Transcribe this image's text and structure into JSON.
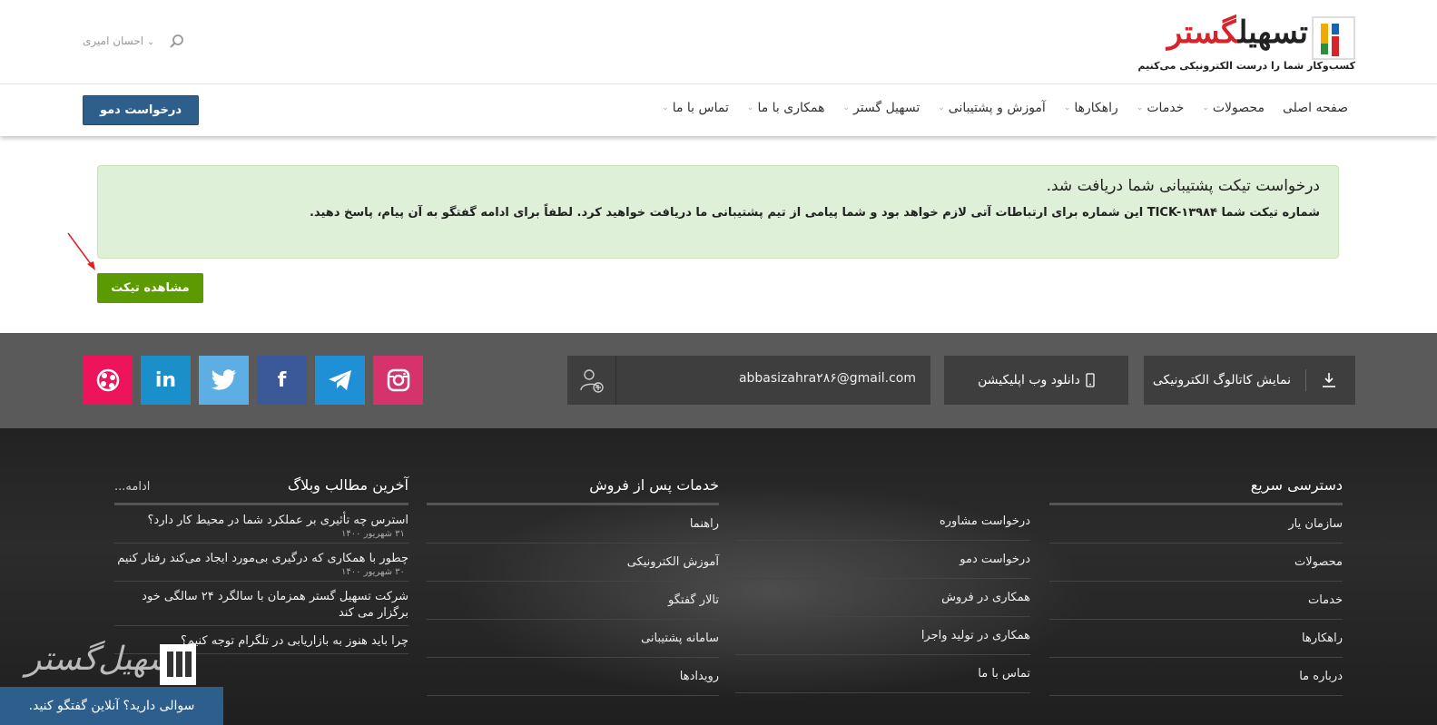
{
  "header": {
    "logo_text": "تسهیل‌گستر",
    "logo_tagline": "کسب‌وکار شما را درست الکترونیکی می‌کنیم",
    "user_name": "احسان امیری",
    "user_chevron": "⌄"
  },
  "nav": {
    "items": [
      {
        "label": "صفحه اصلی",
        "has_chevron": false
      },
      {
        "label": "محصولات",
        "has_chevron": true
      },
      {
        "label": "خدمات",
        "has_chevron": true
      },
      {
        "label": "راهکارها",
        "has_chevron": true
      },
      {
        "label": "آموزش و پشتیبانی",
        "has_chevron": true
      },
      {
        "label": "تسهیل گستر",
        "has_chevron": true
      },
      {
        "label": "همکاری با ما",
        "has_chevron": true
      },
      {
        "label": "تماس با ما",
        "has_chevron": true
      }
    ],
    "demo_button": "درخواست دمو"
  },
  "alert": {
    "title": "درخواست تیکت پشتیبانی شما دریافت شد.",
    "message": "شماره تیکت شما TICK-۱۳۹۸۴ این شماره برای ارتباطات آتی لازم خواهد بود و شما پیامی از تیم پشتیبانی ما دریافت خواهید کرد. لطفاً برای ادامه گفتگو به آن پیام، پاسخ دهید.",
    "color": "#dff0d8"
  },
  "ticket_button": "مشاهده تیکت",
  "footer_strip": {
    "catalog_button": "نمایش کاتالوگ الکترونیکی",
    "app_button": "دانلود وب اپلیکیشن",
    "email_value": "abbasizahra۲۸۶@gmail.com",
    "socials": [
      {
        "name": "aparat",
        "color": "#ed145b"
      },
      {
        "name": "linkedin",
        "color": "#1a8fc9"
      },
      {
        "name": "twitter",
        "color": "#5eaee6"
      },
      {
        "name": "facebook",
        "color": "#3b5998"
      },
      {
        "name": "telegram",
        "color": "#1f8fd6"
      },
      {
        "name": "instagram",
        "color": "#d6336c"
      }
    ]
  },
  "footer": {
    "quick_access": {
      "title": "دسترسی سریع",
      "items": [
        "سازمان یار",
        "محصولات",
        "خدمات",
        "راهکارها",
        "درباره ما"
      ]
    },
    "services_col2": {
      "items": [
        "درخواست مشاوره",
        "درخواست دمو",
        "همکاری در فروش",
        "همکاری در تولید واجرا",
        "تماس با ما"
      ]
    },
    "after_sales": {
      "title": "خدمات پس از فروش",
      "items": [
        "راهنما",
        "آموزش الکترونیکی",
        "تالار گفتگو",
        "سامانه پشتیبانی",
        "رویدادها"
      ]
    },
    "blog": {
      "title": "آخرین مطالب وبلاگ",
      "more": "ادامه...",
      "posts": [
        {
          "title": "استرس چه تأثیری بر عملکرد شما در محیط کار دارد؟",
          "date": "۳۱ شهریور ۱۴۰۰"
        },
        {
          "title": "چطور با همکاری که درگیری بی‌مورد ایجاد می‌کند رفتار کنیم",
          "date": "۳۰ شهریور ۱۴۰۰"
        },
        {
          "title": "شرکت تسهیل گستر همزمان با سالگرد ۲۴ سالگی خود برگزار می کند",
          "date": ""
        },
        {
          "title": "چرا باید هنوز به بازاریابی در تلگرام توجه کنیم؟",
          "date": ""
        }
      ]
    }
  },
  "chat": {
    "label": "سوالی دارید؟ آنلاین گفتگو کنید.",
    "logo_text": "تسهیل‌گستر"
  }
}
